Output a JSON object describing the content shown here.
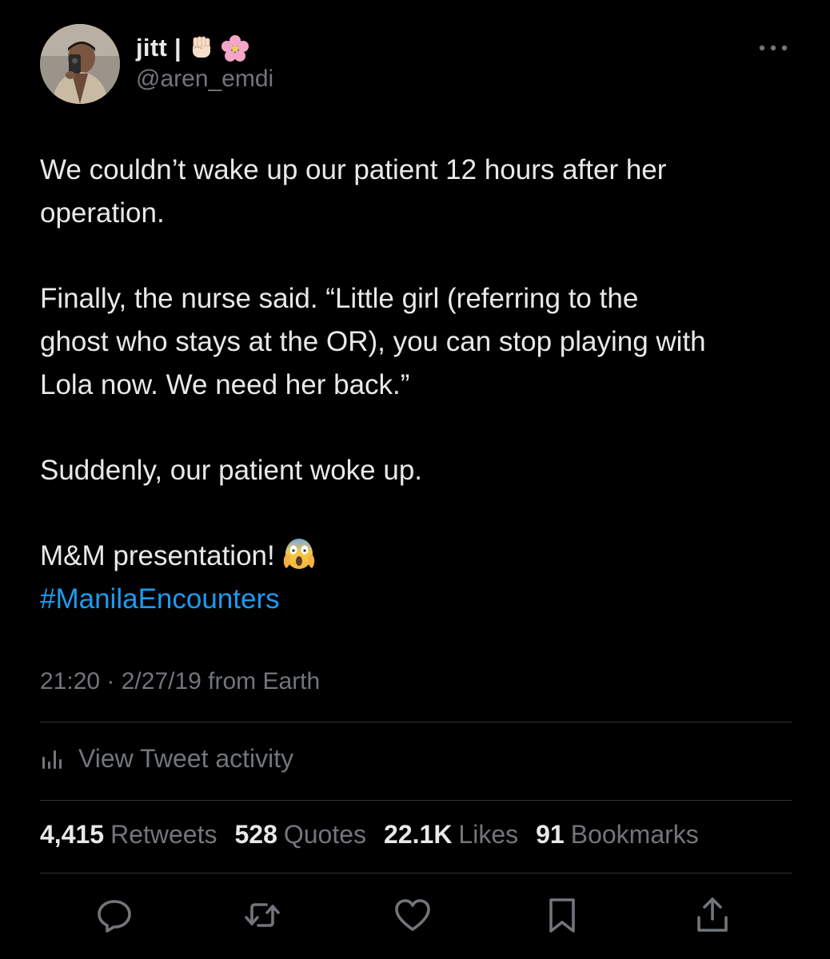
{
  "author": {
    "display_name": "jitt |",
    "handle": "@aren_emdi"
  },
  "tweet": {
    "paragraphs": [
      [
        "We couldn’t wake up our patient 12 hours after her",
        "operation."
      ],
      [
        "Finally, the nurse said. “Little girl (referring to the",
        "ghost who stays at the OR), you can stop playing with",
        "Lola now. We need her back.”"
      ],
      [
        "Suddenly, our patient woke up."
      ]
    ],
    "closing_text": "M&M presentation!",
    "hashtag": "#ManilaEncounters"
  },
  "timestamp": "21:20 · 2/27/19 from Earth",
  "activity_label": "View Tweet activity",
  "stats": {
    "retweets": {
      "count": "4,415",
      "label": "Retweets"
    },
    "quotes": {
      "count": "528",
      "label": "Quotes"
    },
    "likes": {
      "count": "22.1K",
      "label": "Likes"
    },
    "bookmarks": {
      "count": "91",
      "label": "Bookmarks"
    }
  },
  "icons": {
    "more": "more-dots-icon",
    "fist": "raised-fist-emoji",
    "flower": "cherry-blossom-emoji",
    "scream": "face-screaming-in-fear-emoji",
    "activity": "analytics-bars-icon",
    "reply": "reply-icon",
    "retweet": "retweet-icon",
    "like": "heart-icon",
    "bookmark": "bookmark-icon",
    "share": "share-icon"
  },
  "colors": {
    "background": "#000000",
    "text": "#e7e9ea",
    "secondary": "#71767b",
    "link": "#1d9bf0",
    "divider": "#2f3336"
  }
}
